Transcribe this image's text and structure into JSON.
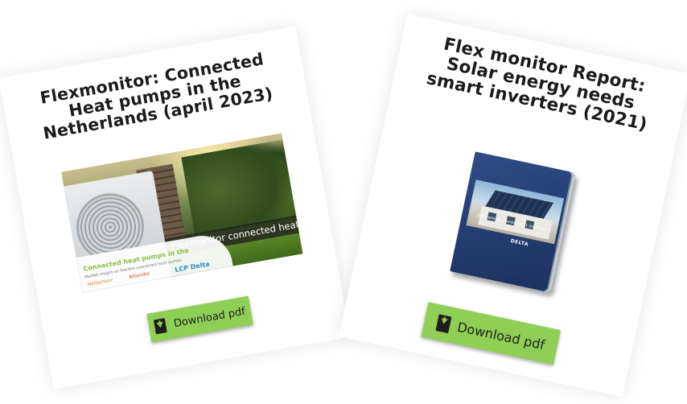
{
  "cards": [
    {
      "title": "Flexmonitor: Connected Heat pumps in the Netherlands (april 2023)",
      "cover": {
        "overlay_label": "Flexmonitor connected heatpumps",
        "panel_title": "Connected heat pumps in the",
        "panel_subtitle": "Market insight on flexible connected heat pumps",
        "logos": [
          "Netbeheer",
          "Alliander",
          "LCP Delta"
        ]
      },
      "button": {
        "label": "Download pdf",
        "icon": "file-download-icon"
      }
    },
    {
      "title": "Flex monitor Report: Solar energy needs smart inverters (2021)",
      "cover": {
        "photo_title": "Solar energy needs smart inverters",
        "brand": "DELTA"
      },
      "button": {
        "label": "Download pdf",
        "icon": "file-download-icon"
      }
    }
  ],
  "colors": {
    "button_bg": "#8fcf55",
    "text": "#1b1b1b",
    "book_blue": "#233c6e"
  }
}
